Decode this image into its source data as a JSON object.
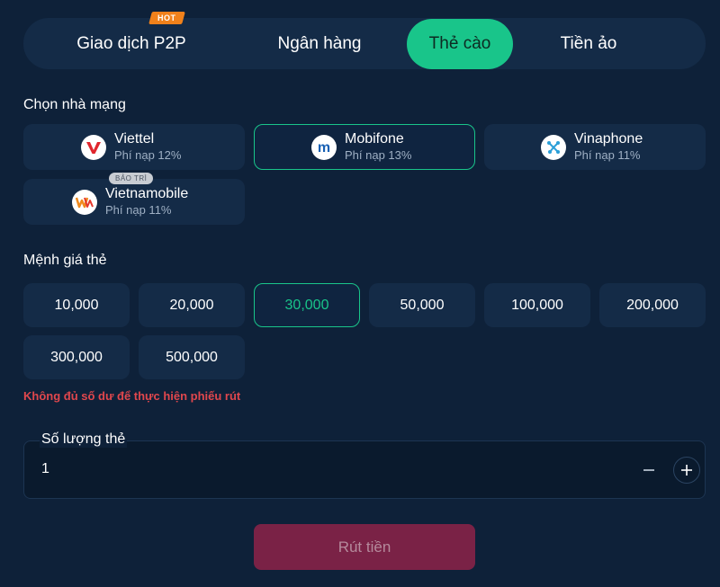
{
  "tabs": {
    "p2p": "Giao dịch P2P",
    "hot_badge": "HOT",
    "bank": "Ngân hàng",
    "card": "Thẻ cào",
    "crypto": "Tiền ảo"
  },
  "carrier_section": {
    "title": "Chọn nhà mạng",
    "carriers": [
      {
        "name": "Viettel",
        "fee": "Phí nạp 12%",
        "icon": "viettel-logo-icon"
      },
      {
        "name": "Mobifone",
        "fee": "Phí nạp 13%",
        "icon": "mobifone-logo-icon",
        "selected": true
      },
      {
        "name": "Vinaphone",
        "fee": "Phí nạp 11%",
        "icon": "vinaphone-logo-icon"
      },
      {
        "name": "Vietnamobile",
        "fee": "Phí nạp 11%",
        "icon": "vietnamobile-logo-icon",
        "badge": "BẢO TRÌ"
      }
    ]
  },
  "denomination_section": {
    "title": "Mệnh giá thẻ",
    "values": [
      "10,000",
      "20,000",
      "30,000",
      "50,000",
      "100,000",
      "200,000",
      "300,000",
      "500,000"
    ],
    "selected": "30,000"
  },
  "error_message": "Không đủ số dư để thực hiện phiếu rút",
  "quantity": {
    "label": "Số lượng thẻ",
    "value": "1"
  },
  "submit_label": "Rút tiền",
  "colors": {
    "background": "#0e2139",
    "card": "#142b47",
    "accent": "#19c58a",
    "error": "#e0474d",
    "submit": "#7a2246"
  }
}
